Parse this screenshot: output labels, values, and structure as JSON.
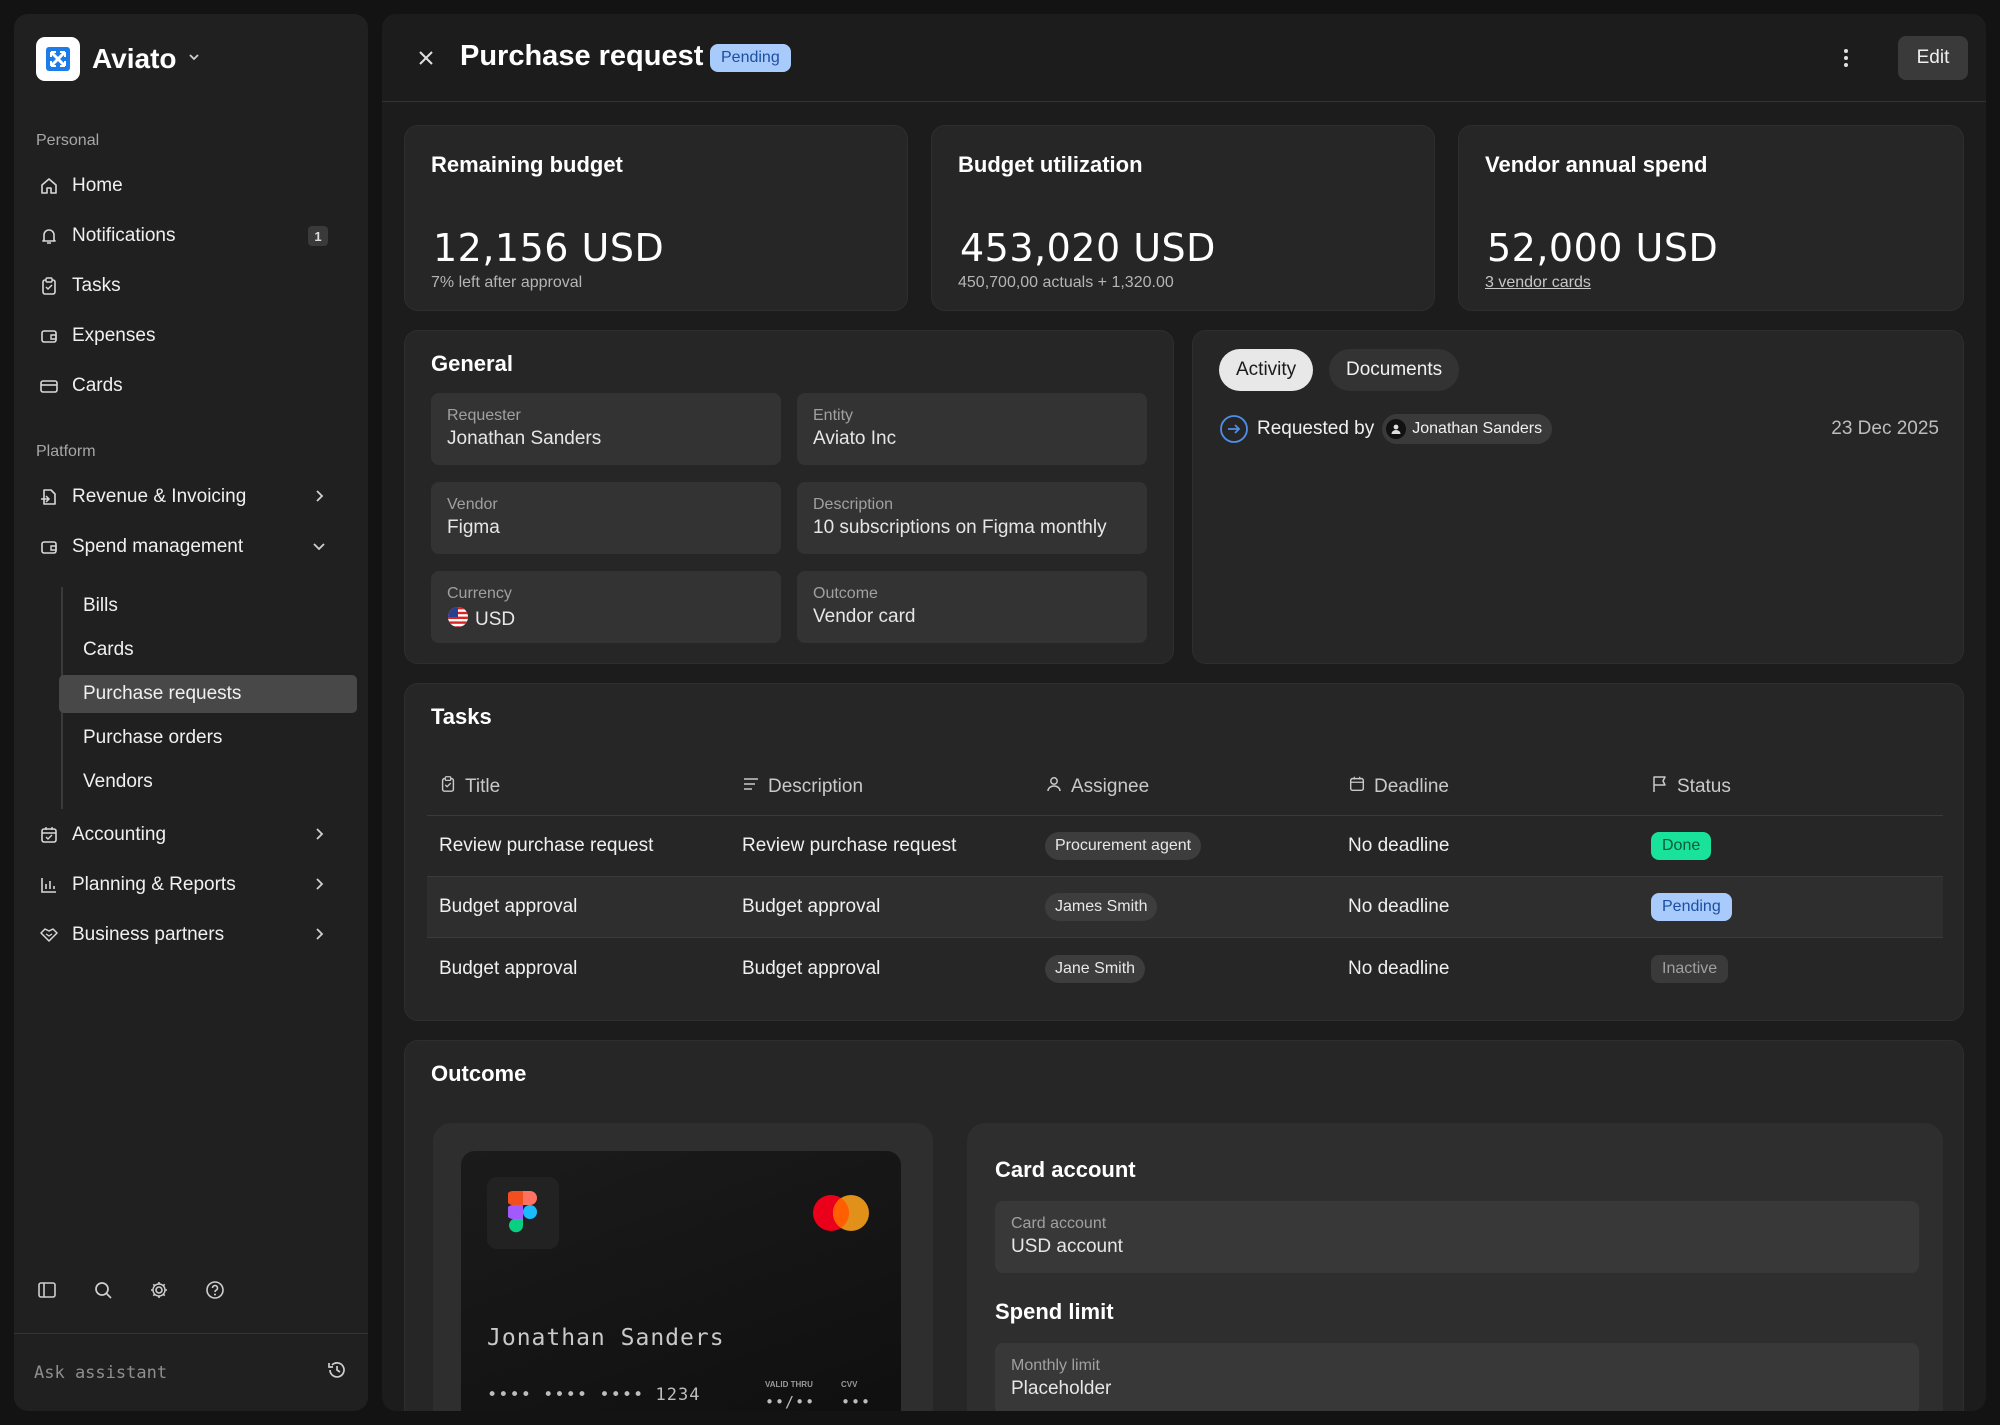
{
  "brand": {
    "name": "Aviato"
  },
  "sidebar": {
    "personal_label": "Personal",
    "personal_items": [
      {
        "label": "Home",
        "icon": "home-icon"
      },
      {
        "label": "Notifications",
        "icon": "bell-icon",
        "badge": "1"
      },
      {
        "label": "Tasks",
        "icon": "clipboard-icon"
      },
      {
        "label": "Expenses",
        "icon": "wallet-icon"
      },
      {
        "label": "Cards",
        "icon": "credit-card-icon"
      }
    ],
    "platform_label": "Platform",
    "platform_items": [
      {
        "label": "Revenue & Invoicing",
        "icon": "invoice-icon"
      },
      {
        "label": "Spend management",
        "icon": "wallet-icon",
        "expanded": true
      },
      {
        "label": "Accounting",
        "icon": "calendar-icon"
      },
      {
        "label": "Planning & Reports",
        "icon": "bar-chart-icon"
      },
      {
        "label": "Business partners",
        "icon": "handshake-icon"
      }
    ],
    "spend_sub_items": [
      {
        "label": "Bills"
      },
      {
        "label": "Cards"
      },
      {
        "label": "Purchase requests",
        "active": true
      },
      {
        "label": "Purchase orders"
      },
      {
        "label": "Vendors"
      }
    ],
    "assistant_placeholder": "Ask assistant"
  },
  "header": {
    "title": "Purchase request",
    "status": "Pending",
    "edit_label": "Edit"
  },
  "stats": [
    {
      "title": "Remaining budget",
      "value": "12,156 USD",
      "sub": "7% left after approval"
    },
    {
      "title": "Budget utilization",
      "value": "453,020 USD",
      "sub": "450,700,00 actuals + 1,320.00"
    },
    {
      "title": "Vendor annual spend",
      "value": "52,000 USD",
      "sub": "3 vendor cards"
    }
  ],
  "general": {
    "title": "General",
    "fields": [
      {
        "label": "Requester",
        "value": "Jonathan Sanders"
      },
      {
        "label": "Entity",
        "value": "Aviato Inc"
      },
      {
        "label": "Vendor",
        "value": "Figma"
      },
      {
        "label": "Description",
        "value": "10 subscriptions on Figma monthly"
      },
      {
        "label": "Currency",
        "value": "USD"
      },
      {
        "label": "Outcome",
        "value": "Vendor card"
      }
    ]
  },
  "activity": {
    "tabs": [
      "Activity",
      "Documents"
    ],
    "entry": {
      "text": "Requested by",
      "user": "Jonathan Sanders",
      "date": "23 Dec 2025"
    }
  },
  "tasks": {
    "title": "Tasks",
    "columns": [
      "Title",
      "Description",
      "Assignee",
      "Deadline",
      "Status"
    ],
    "rows": [
      {
        "title": "Review purchase request",
        "description": "Review purchase request",
        "assignee": "Procurement agent",
        "deadline": "No deadline",
        "status": "Done"
      },
      {
        "title": "Budget approval",
        "description": "Budget approval",
        "assignee": "James Smith",
        "deadline": "No deadline",
        "status": "Pending"
      },
      {
        "title": "Budget approval",
        "description": "Budget approval",
        "assignee": "Jane Smith",
        "deadline": "No deadline",
        "status": "Inactive"
      }
    ]
  },
  "outcome": {
    "title": "Outcome",
    "card": {
      "holder": "Jonathan Sanders",
      "number": "•••• •••• •••• 1234",
      "valid_label": "VALID THRU",
      "valid_value": "••/••",
      "cvv_label": "CVV",
      "cvv_value": "•••"
    },
    "card_account_title": "Card account",
    "card_account_label": "Card account",
    "card_account_value": "USD account",
    "spend_limit_title": "Spend limit",
    "spend_limit_label": "Monthly limit",
    "spend_limit_value": "Placeholder"
  },
  "colors": {
    "pending_bg": "#a9cbfb",
    "done_bg": "#19e29a",
    "inactive_bg": "#3a3a3a",
    "brand_blue": "#1e7ce6"
  }
}
